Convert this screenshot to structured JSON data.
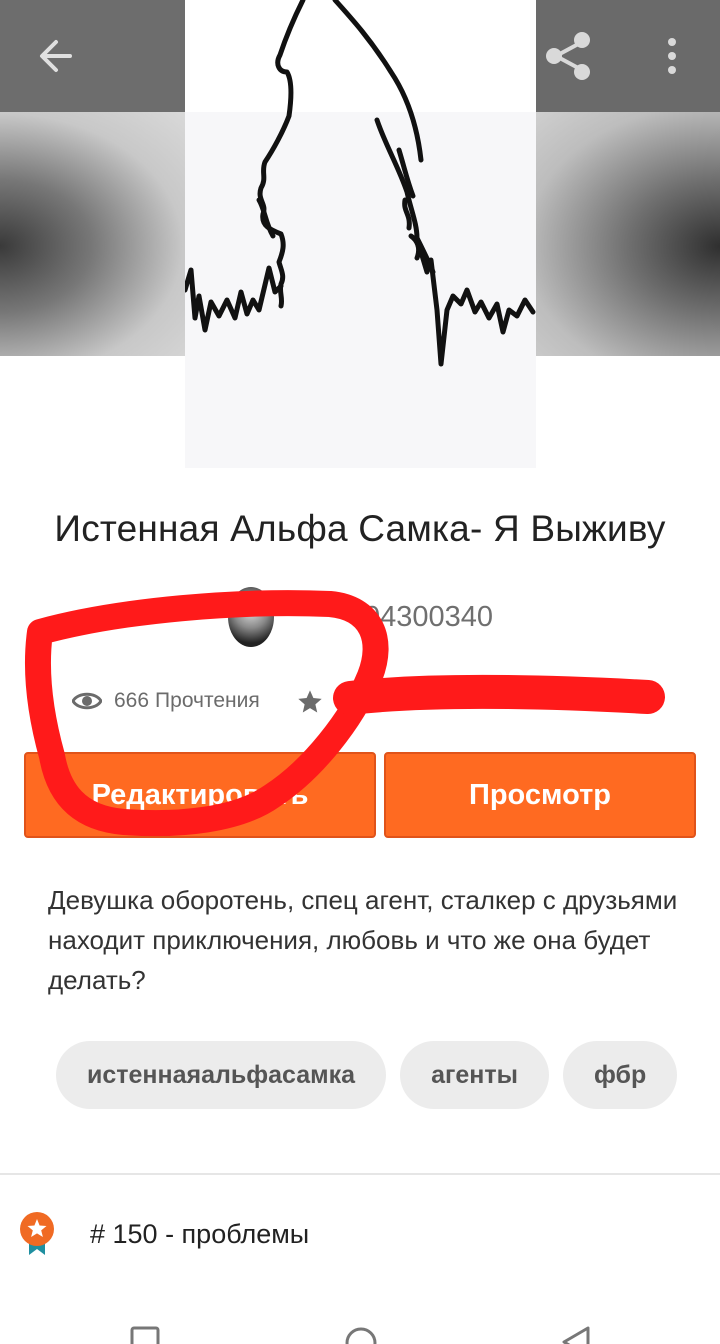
{
  "header": {
    "back_icon": "arrow-left-icon",
    "share_icon": "share-icon",
    "more_icon": "more-vert-icon"
  },
  "story": {
    "title": "Истенная Альфа Самка- Я Выживу",
    "author_name": "04300340",
    "reads_count": "666",
    "reads_label": "Прочтения",
    "description": "Девушка оборотень, спец агент, сталкер с друзьями  находит приключения, любовь и что же она будет делать?"
  },
  "actions": {
    "edit_label": "Редактировать",
    "view_label": "Просмотр"
  },
  "tags": [
    "истеннаяальфасамка",
    "агенты",
    "фбр"
  ],
  "ranking": {
    "text": "# 150 - проблемы"
  },
  "colors": {
    "accent": "#ff6a21",
    "annotation": "#ff1a1a"
  }
}
